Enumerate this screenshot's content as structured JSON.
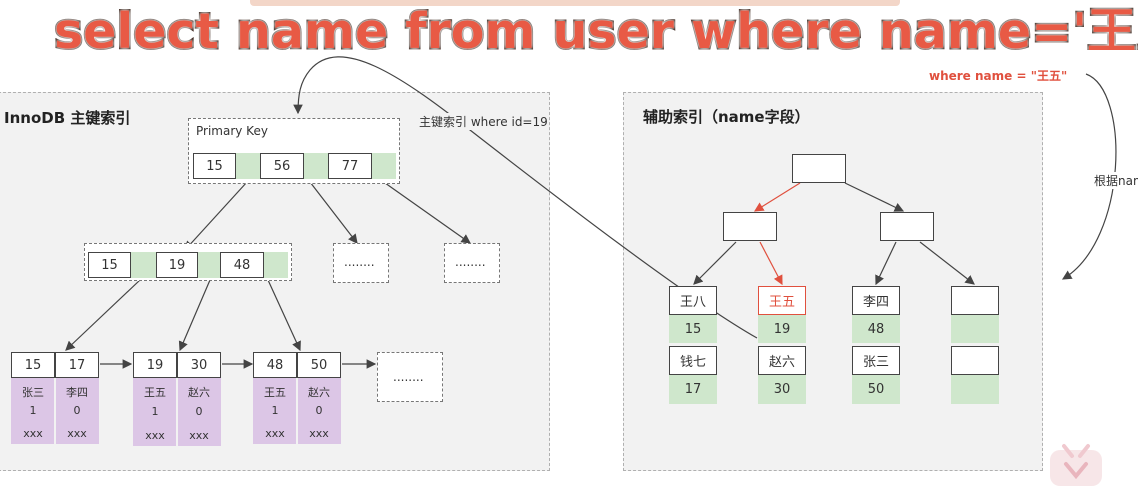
{
  "banner": {
    "sql": "select name from user where name='王五'"
  },
  "left": {
    "title": "InnoDB 主键索引",
    "root_label": "Primary Key",
    "root_keys": [
      "15",
      "56",
      "77"
    ],
    "level2_keys": [
      "15",
      "19",
      "48"
    ],
    "ellipsis": "........",
    "annotation": "主键索引 where id=19",
    "leaves": [
      {
        "keys": [
          "15",
          "17"
        ],
        "rows": [
          [
            "张三",
            "1",
            "xxx"
          ],
          [
            "李四",
            "0",
            "xxx"
          ]
        ]
      },
      {
        "keys": [
          "19",
          "30"
        ],
        "rows": [
          [
            "王五",
            "1",
            "xxx"
          ],
          [
            "赵六",
            "0",
            "xxx"
          ]
        ]
      },
      {
        "keys": [
          "48",
          "50"
        ],
        "rows": [
          [
            "王五",
            "1",
            "xxx"
          ],
          [
            "赵六",
            "0",
            "xxx"
          ]
        ]
      }
    ]
  },
  "right": {
    "title": "辅助索引（name字段）",
    "where_label": "where name = \"王五\"",
    "side_note": "根据nam",
    "columns": [
      {
        "top_name": "王八",
        "top_id": "15",
        "bottom_name": "钱七",
        "bottom_id": "17"
      },
      {
        "top_name": "王五",
        "top_id": "19",
        "bottom_name": "赵六",
        "bottom_id": "30"
      },
      {
        "top_name": "李四",
        "top_id": "48",
        "bottom_name": "张三",
        "bottom_id": "50"
      },
      {
        "top_name": "",
        "top_id": "",
        "bottom_name": "",
        "bottom_id": ""
      }
    ]
  },
  "colors": {
    "highlight": "#e0503e",
    "green": "#cfe7cc",
    "purple": "#dcc6e6",
    "panel": "#f2f2f2"
  }
}
